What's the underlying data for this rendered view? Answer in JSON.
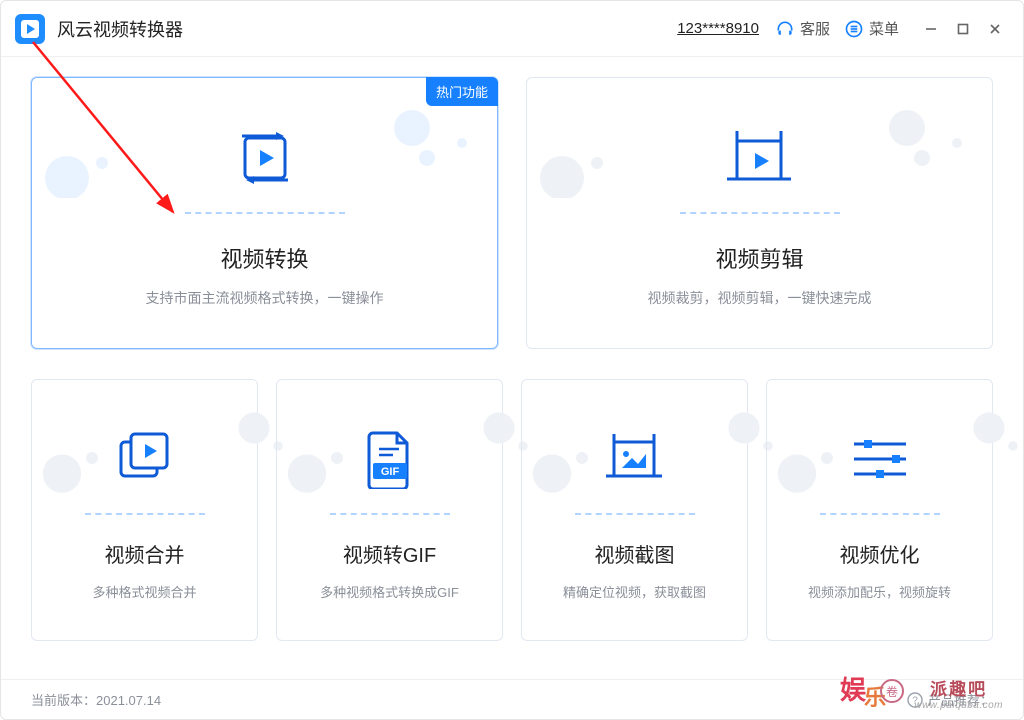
{
  "app": {
    "title": "风云视频转换器"
  },
  "header": {
    "user_id": "123****8910",
    "support_label": "客服",
    "menu_label": "菜单"
  },
  "badges": {
    "hot": "热门功能"
  },
  "cards": {
    "convert": {
      "title": "视频转换",
      "desc": "支持市面主流视频格式转换，一键操作"
    },
    "edit": {
      "title": "视频剪辑",
      "desc": "视频裁剪，视频剪辑，一键快速完成"
    },
    "merge": {
      "title": "视频合并",
      "desc": "多种格式视频合并"
    },
    "gif": {
      "title": "视频转GIF",
      "desc": "多种视频格式转换成GIF",
      "gif_label": "GIF"
    },
    "shot": {
      "title": "视频截图",
      "desc": "精确定位视频，获取截图"
    },
    "optimize": {
      "title": "视频优化",
      "desc": "视频添加配乐，视频旋转"
    }
  },
  "footer": {
    "version_prefix": "当前版本：",
    "version": "2021.07.14",
    "recommend": "产品推荐："
  },
  "watermark": {
    "brand_cn": "派趣吧",
    "url": "www.paiquba.com"
  },
  "colors": {
    "primary": "#1780ff"
  }
}
